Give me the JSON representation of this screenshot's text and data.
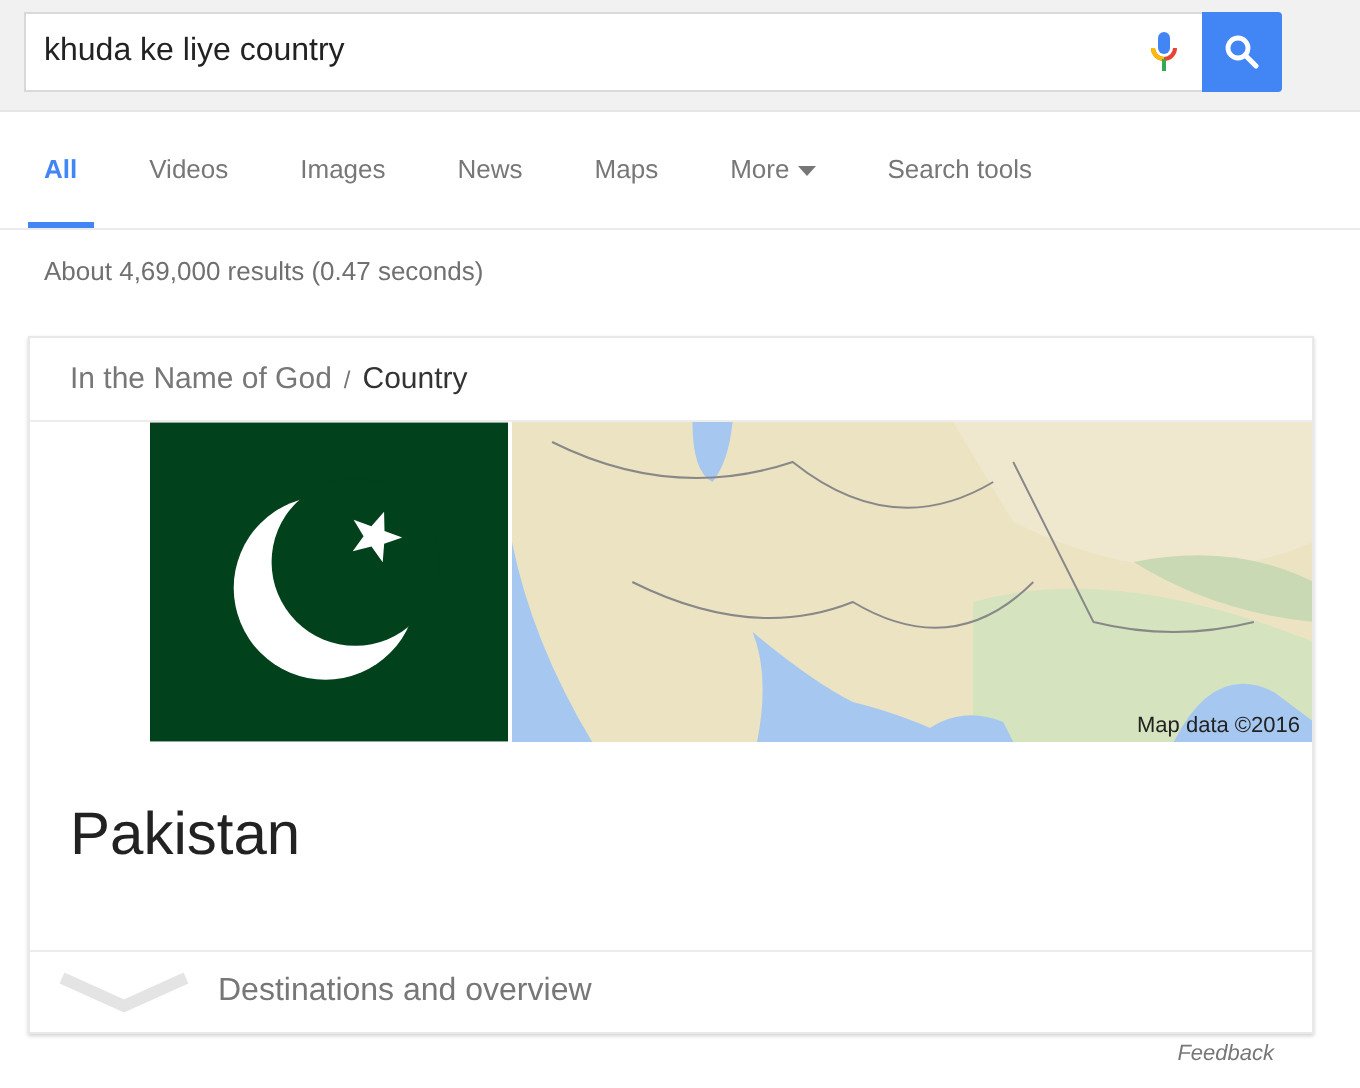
{
  "search": {
    "value": "khuda ke liye country"
  },
  "tabs": [
    {
      "label": "All",
      "selected": true
    },
    {
      "label": "Videos",
      "selected": false
    },
    {
      "label": "Images",
      "selected": false
    },
    {
      "label": "News",
      "selected": false
    },
    {
      "label": "Maps",
      "selected": false
    },
    {
      "label": "More",
      "selected": false,
      "dropdown": true
    },
    {
      "label": "Search tools",
      "selected": false
    }
  ],
  "result_stats": "About 4,69,000 results (0.47 seconds)",
  "knowledge_card": {
    "breadcrumb": [
      "In the Name of God",
      "Country"
    ],
    "separator": "/",
    "map": {
      "attribution": "Map data ©2016"
    },
    "title": "Pakistan",
    "expander": "Destinations and overview"
  },
  "feedback": "Feedback"
}
